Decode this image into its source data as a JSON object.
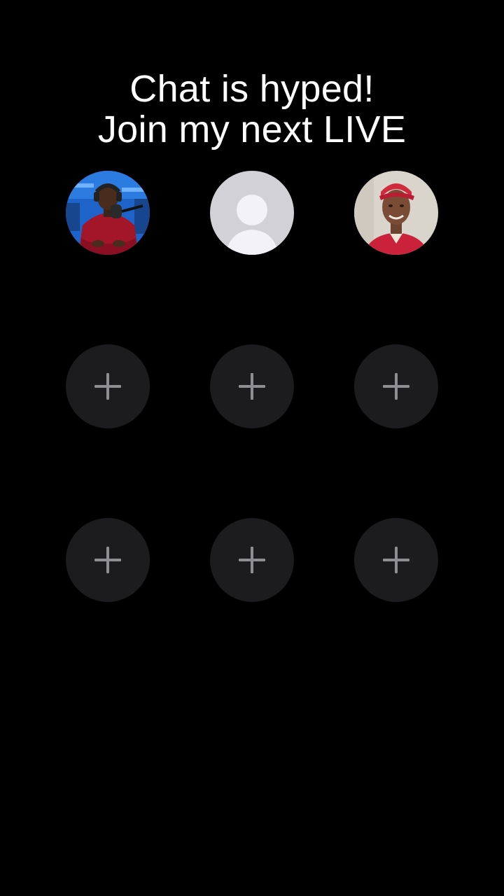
{
  "headline": {
    "line1": "Chat is hyped!",
    "line2": "Join my next LIVE"
  },
  "participants": [
    {
      "icon": "host-avatar-photo",
      "kind": "photo"
    },
    {
      "icon": "default-user-icon",
      "kind": "placeholder"
    },
    {
      "icon": "guest-avatar-photo",
      "kind": "photo"
    }
  ],
  "empty_slots": {
    "icon": "plus-icon",
    "count": 6
  },
  "colors": {
    "background": "#000000",
    "slot_background": "#1c1c1e",
    "plus": "#8e8e93",
    "placeholder_bg": "#d1d1d6",
    "placeholder_figure": "#f2f2f7"
  }
}
